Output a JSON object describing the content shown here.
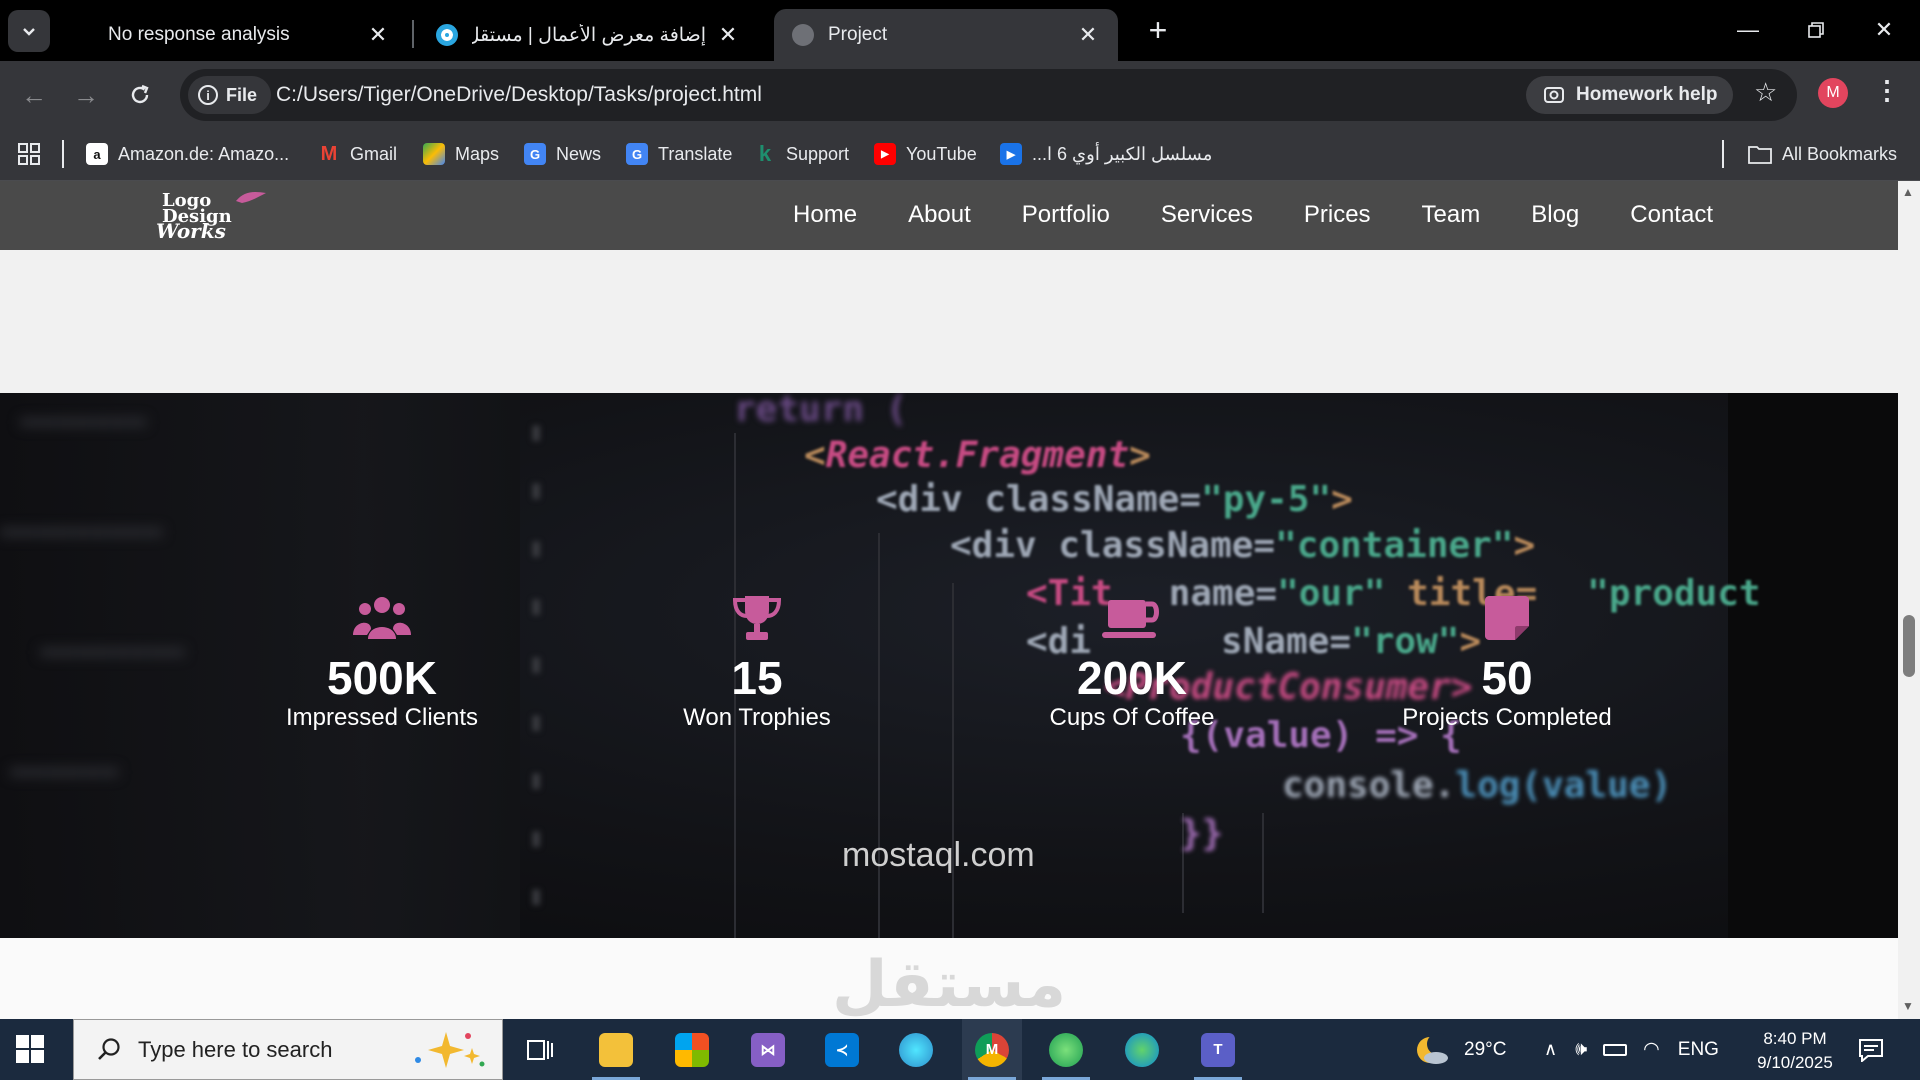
{
  "tabs": [
    {
      "title": "No response analysis",
      "active": false
    },
    {
      "title": "إضافة معرض الأعمال | مستقل",
      "active": false
    },
    {
      "title": "Project",
      "active": true
    }
  ],
  "toolbar": {
    "file_label": "File",
    "url": "C:/Users/Tiger/OneDrive/Desktop/Tasks/project.html",
    "homework_label": "Homework help",
    "profile_initial": "M"
  },
  "bookmarks": [
    {
      "label": "Amazon.de: Amazo...",
      "icon": "amazon-icon",
      "color": "#ffffff"
    },
    {
      "label": "Gmail",
      "icon": "gmail-icon",
      "color": "#ea4335"
    },
    {
      "label": "Maps",
      "icon": "maps-icon",
      "color": "#34a853"
    },
    {
      "label": "News",
      "icon": "news-icon",
      "color": "#4285f4"
    },
    {
      "label": "Translate",
      "icon": "translate-icon",
      "color": "#4285f4"
    },
    {
      "label": "Support",
      "icon": "support-icon",
      "color": "#1e8e6e"
    },
    {
      "label": "YouTube",
      "icon": "youtube-icon",
      "color": "#ff0000"
    },
    {
      "label": "مسلسل الكبير أوي 6 ا...",
      "icon": "video-icon",
      "color": "#1a73e8"
    }
  ],
  "all_bookmarks_label": "All Bookmarks",
  "site": {
    "logo_lines": [
      "Logo",
      "Design",
      "Works"
    ],
    "nav": [
      "Home",
      "About",
      "Portfolio",
      "Services",
      "Prices",
      "Team",
      "Blog",
      "Contact"
    ],
    "accent": "#c75b9b",
    "stats": [
      {
        "value": "500K",
        "label": "Impressed Clients",
        "icon": "users-icon"
      },
      {
        "value": "15",
        "label": "Won Trophies",
        "icon": "trophy-icon"
      },
      {
        "value": "200K",
        "label": "Cups Of Coffee",
        "icon": "coffee-cup-icon"
      },
      {
        "value": "50",
        "label": "Projects Completed",
        "icon": "sticky-note-icon"
      }
    ],
    "code_lines": {
      "l1": "return (",
      "l2a": "<",
      "l2b": "React.Fragment",
      "l2c": ">",
      "l3a": "<div className=",
      "l3b": "\"py-5\"",
      "l3c": ">",
      "l4a": "<div className=",
      "l4b": "\"container\"",
      "l4c": ">",
      "l5a": "<Tit",
      "l5b": "name=",
      "l5c": "\"our\"",
      "l5d": " title=",
      "l5e": "\"product",
      "l6a": "<di",
      "l6b": "sName=",
      "l6c": "\"row\"",
      "l6d": ">",
      "l7": "<ProductConsumer>",
      "l8": "{(value) => {",
      "l9a": "console.",
      "l9b": "log",
      "l9c": "(value)",
      "l10": "}}"
    },
    "watermark": "مستقل",
    "watermark_sub": "mostaql.com"
  },
  "taskbar": {
    "search_placeholder": "Type here to search",
    "weather": "29°C",
    "language": "ENG",
    "time": "8:40 PM",
    "date": "9/10/2025",
    "apps": [
      {
        "name": "task-view-icon",
        "color": "#1b2a3e"
      },
      {
        "name": "file-explorer-icon",
        "color": "#f3c13a"
      },
      {
        "name": "microsoft-store-icon",
        "color": "#f25022"
      },
      {
        "name": "visual-studio-icon",
        "color": "#865fc5"
      },
      {
        "name": "vscode-icon",
        "color": "#0078d4"
      },
      {
        "name": "edge-profile-icon",
        "color": "#2d8ecb"
      },
      {
        "name": "chrome-icon",
        "color": "#db4437"
      },
      {
        "name": "edge-dev-icon",
        "color": "#1e9e52"
      },
      {
        "name": "edge-icon",
        "color": "#0c8ad6"
      },
      {
        "name": "teams-icon",
        "color": "#5b5fc7"
      }
    ]
  }
}
